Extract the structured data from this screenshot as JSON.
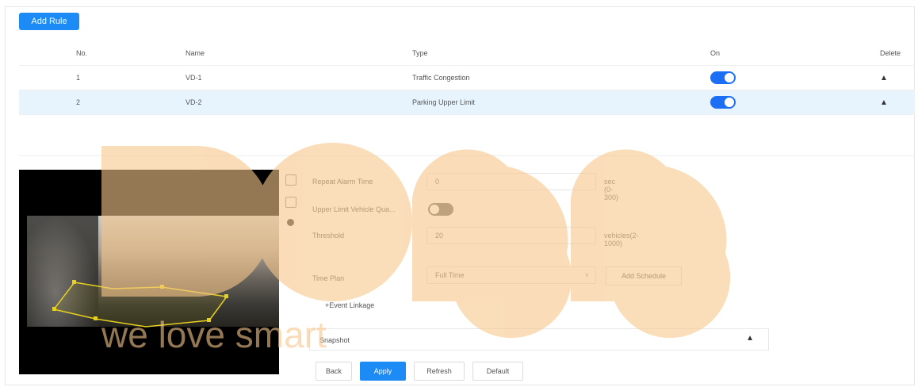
{
  "toolbar": {
    "add_rule_label": "Add Rule"
  },
  "table": {
    "headers": {
      "no": "No.",
      "name": "Name",
      "type": "Type",
      "on": "On",
      "delete": "Delete"
    },
    "rows": [
      {
        "no": "1",
        "name": "VD-1",
        "type": "Traffic Congestion",
        "on": true
      },
      {
        "no": "2",
        "name": "VD-2",
        "type": "Parking Upper Limit",
        "on": true
      }
    ]
  },
  "form": {
    "repeat_alarm_time_label": "Repeat Alarm Time",
    "repeat_alarm_time_value": "0",
    "repeat_alarm_time_unit": "sec (0-300)",
    "upper_limit_label": "Upper Limit Vehicle Qua...",
    "threshold_label": "Threshold",
    "threshold_value": "20",
    "threshold_unit": "vehicles(2-1000)",
    "time_plan_label": "Time Plan",
    "time_plan_value": "Full Time",
    "add_schedule_label": "Add Schedule",
    "event_linkage_label": "+Event Linkage",
    "event_row_label": "Snapshot"
  },
  "buttons": {
    "back": "Back",
    "apply": "Apply",
    "refresh": "Refresh",
    "default": "Default"
  },
  "watermark": {
    "text": "we love smart"
  },
  "colors": {
    "accent": "#1c8bf5",
    "selected_row": "#e8f4fd",
    "watermark": "#f7c78a"
  }
}
